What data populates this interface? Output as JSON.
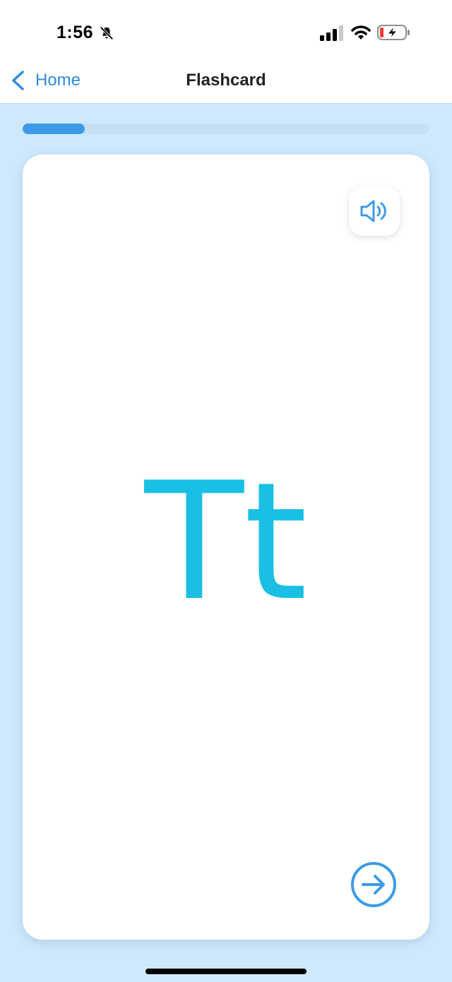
{
  "status_bar": {
    "time": "1:56",
    "icons": [
      "bell-slash-icon",
      "cellular-signal-icon",
      "wifi-icon",
      "battery-charging-icon"
    ]
  },
  "nav": {
    "back_label": "Home",
    "title": "Flashcard"
  },
  "progress": {
    "fraction": 0.153
  },
  "card": {
    "letter": "Tt",
    "sound_icon": "speaker-icon",
    "next_icon": "arrow-right-circle-icon"
  },
  "colors": {
    "accent": "#2f8ae0",
    "progress_fill": "#3d9ae8",
    "letter": "#19c0e3",
    "background": "#cfe8fb"
  }
}
